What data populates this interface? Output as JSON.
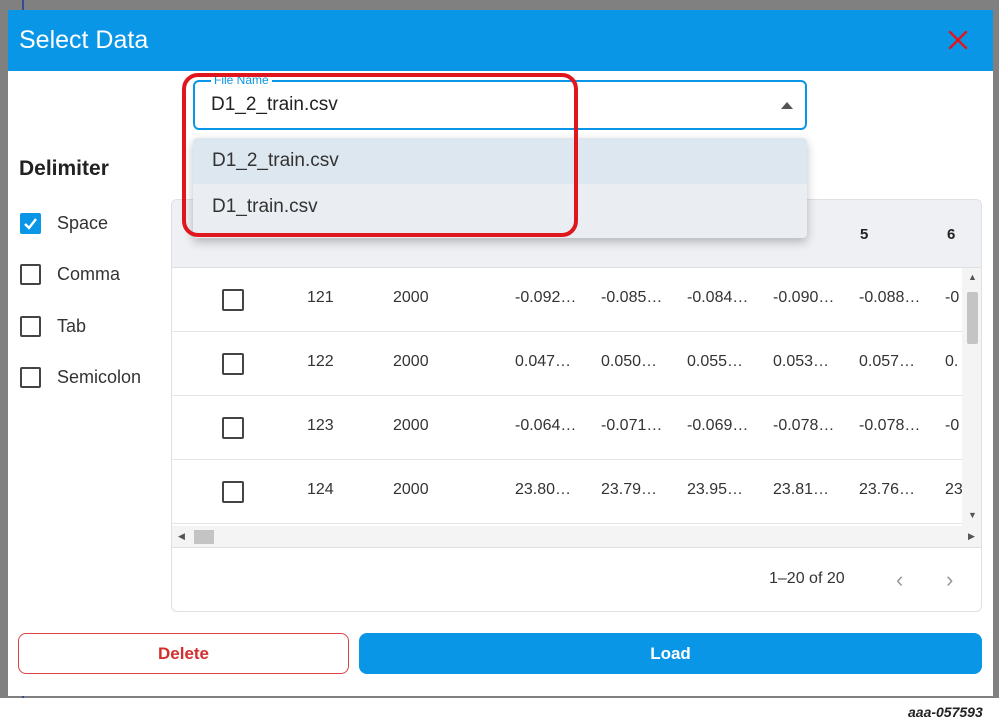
{
  "dialog": {
    "title": "Select Data"
  },
  "file_select": {
    "label": "File Name",
    "value": "D1_2_train.csv",
    "options": [
      "D1_2_train.csv",
      "D1_train.csv"
    ],
    "selected_index": 0
  },
  "delimiter": {
    "title": "Delimiter",
    "options": [
      {
        "label": "Space",
        "checked": true
      },
      {
        "label": "Comma",
        "checked": false
      },
      {
        "label": "Tab",
        "checked": false
      },
      {
        "label": "Semicolon",
        "checked": false
      }
    ]
  },
  "table": {
    "headers": [
      "5",
      "6"
    ],
    "rows": [
      [
        "121",
        "2000",
        "-0.092…",
        "-0.085…",
        "-0.084…",
        "-0.090…",
        "-0.088…",
        "-0"
      ],
      [
        "122",
        "2000",
        "0.047…",
        "0.050…",
        "0.055…",
        "0.053…",
        "0.057…",
        "0."
      ],
      [
        "123",
        "2000",
        "-0.064…",
        "-0.071…",
        "-0.069…",
        "-0.078…",
        "-0.078…",
        "-0"
      ],
      [
        "124",
        "2000",
        "23.80…",
        "23.79…",
        "23.95…",
        "23.81…",
        "23.76…",
        "23"
      ]
    ],
    "pagination": "1–20 of 20"
  },
  "actions": {
    "delete": "Delete",
    "load": "Load"
  },
  "caption": "aaa-057593",
  "colors": {
    "accent": "#0a96e6",
    "highlight": "#e0161f",
    "danger": "#d32f2f"
  }
}
